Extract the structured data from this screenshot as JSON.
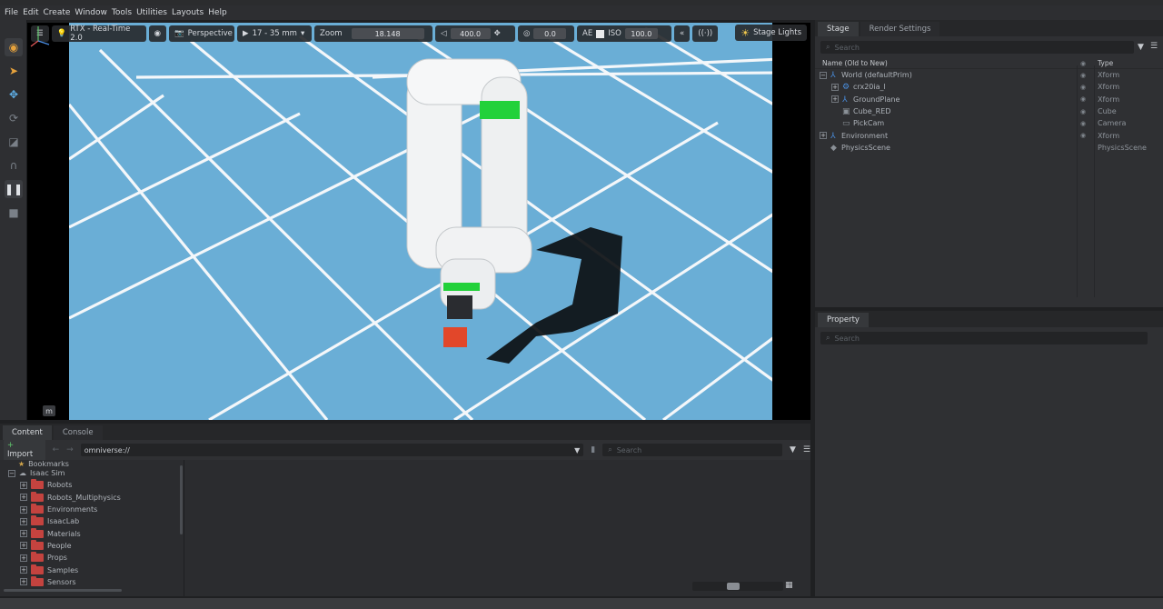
{
  "menu": [
    "File",
    "Edit",
    "Create",
    "Window",
    "Tools",
    "Utilities",
    "Layouts",
    "Help"
  ],
  "viewport": {
    "renderer": "RTX - Real-Time 2.0",
    "camera": "Perspective",
    "lens": "17 - 35 mm",
    "zoom_label": "Zoom",
    "zoom_value": "18.148",
    "speed_value": "400.0",
    "exposure_value": "0.0",
    "ae_label": "AE",
    "iso_label": "ISO",
    "iso_value": "100.0",
    "stage_lights": "Stage Lights",
    "unit": "m",
    "floor_color": "#6aaed6",
    "grid_color": "#f4f7fa",
    "highlight_color": "#22d13a"
  },
  "stage": {
    "tabs": [
      "Stage",
      "Render Settings"
    ],
    "search_placeholder": "Search",
    "col_name": "Name (Old to New)",
    "col_type": "Type",
    "rows": [
      {
        "name": "World (defaultPrim)",
        "type": "Xform",
        "icon": "xform-icon"
      },
      {
        "name": "crx20ia_l",
        "type": "Xform",
        "icon": "robot-icon"
      },
      {
        "name": "GroundPlane",
        "type": "Xform",
        "icon": "xform-icon"
      },
      {
        "name": "Cube_RED",
        "type": "Cube",
        "icon": "cube-icon"
      },
      {
        "name": "PickCam",
        "type": "Camera",
        "icon": "camera-icon"
      },
      {
        "name": "Environment",
        "type": "Xform",
        "icon": "xform-icon"
      },
      {
        "name": "PhysicsScene",
        "type": "PhysicsScene",
        "icon": "physics-icon"
      }
    ]
  },
  "property": {
    "tab": "Property",
    "search_placeholder": "Search"
  },
  "content": {
    "tabs": [
      "Content",
      "Console"
    ],
    "import_label": "Import",
    "path": "omniverse://",
    "search_placeholder": "Search",
    "bookmarks": "Bookmarks",
    "root": "Isaac Sim",
    "folders": [
      "Robots",
      "Robots_Multiphysics",
      "Environments",
      "IsaacLab",
      "Materials",
      "People",
      "Props",
      "Samples",
      "Sensors"
    ]
  }
}
